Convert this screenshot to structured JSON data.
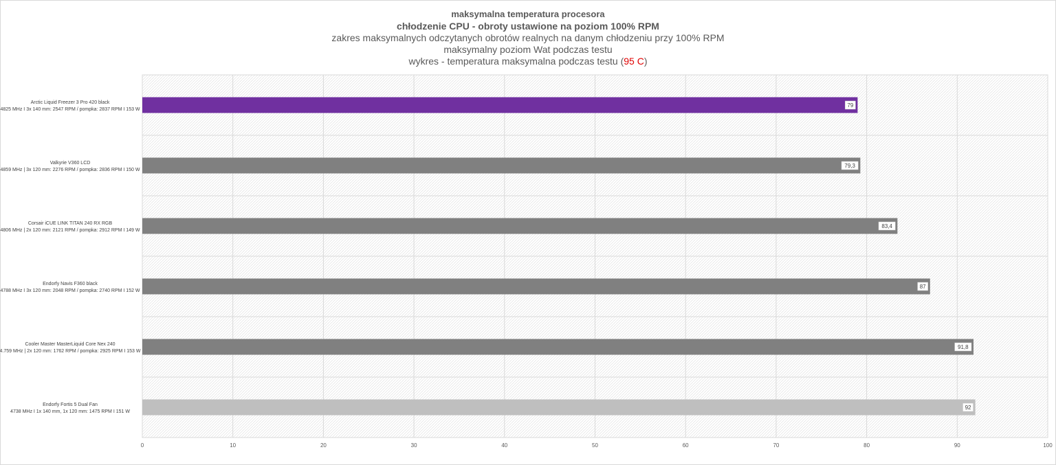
{
  "titles": {
    "line1": "maksymalna temperatura procesora",
    "line2": "chłodzenie CPU - obroty ustawione na poziom 100% RPM",
    "line3": "zakres maksymalnych odczytanych obrotów realnych na danym chłodzeniu przy 100% RPM",
    "line4": "maksymalny poziom Wat podczas testu",
    "line5_before": "wykres - temperatura maksymalna podczas testu (",
    "line5_highlight": "95 C",
    "line5_after": ")"
  },
  "colors": {
    "highlight": "#7030a0",
    "standard": "#808080",
    "light": "#bfbfbf",
    "highlight_text": "#e00000"
  },
  "chart_data": {
    "type": "bar",
    "orientation": "horizontal",
    "categories": [
      [
        "Arctic Liquid Freezer 3 Pro 420 black",
        "4825 MHz I 3x 140 mm: 2547 RPM / pompka: 2837 RPM I 153 W"
      ],
      [
        "Valkyrie V360 LCD",
        "4859 MHz  |  3x 120 mm: 2276 RPM / pompka: 2836 RPM I 150 W"
      ],
      [
        "Corsair iCUE LINK TITAN 240 RX RGB",
        "4806 MHz  |  2x 120 mm: 2121 RPM / pompka: 2912 RPM I 149 W"
      ],
      [
        "Endorfy Navis F360 black",
        "4788 MHz I 3x 120 mm: 2048 RPM / pompka: 2740 RPM I 152 W"
      ],
      [
        "Cooler Master MasterLiquid Core Nex 240",
        "4.759 MHz  |  2x 120 mm: 1762 RPM / pompka: 2925 RPM I 153 W"
      ],
      [
        "Endorfy Fortis 5 Dual Fan",
        "4738 MHz I 1x 140 mm, 1x 120 mm: 1475 RPM I 151 W"
      ]
    ],
    "values": [
      79,
      79.3,
      83.4,
      87,
      91.8,
      92
    ],
    "value_labels": [
      "79",
      "79,3",
      "83,4",
      "87",
      "91,8",
      "92"
    ],
    "bar_colors": [
      "#7030a0",
      "#808080",
      "#808080",
      "#808080",
      "#808080",
      "#bfbfbf"
    ],
    "xlim": [
      0,
      100
    ],
    "xticks": [
      0,
      10,
      20,
      30,
      40,
      50,
      60,
      70,
      80,
      90,
      100
    ],
    "grid": true
  }
}
